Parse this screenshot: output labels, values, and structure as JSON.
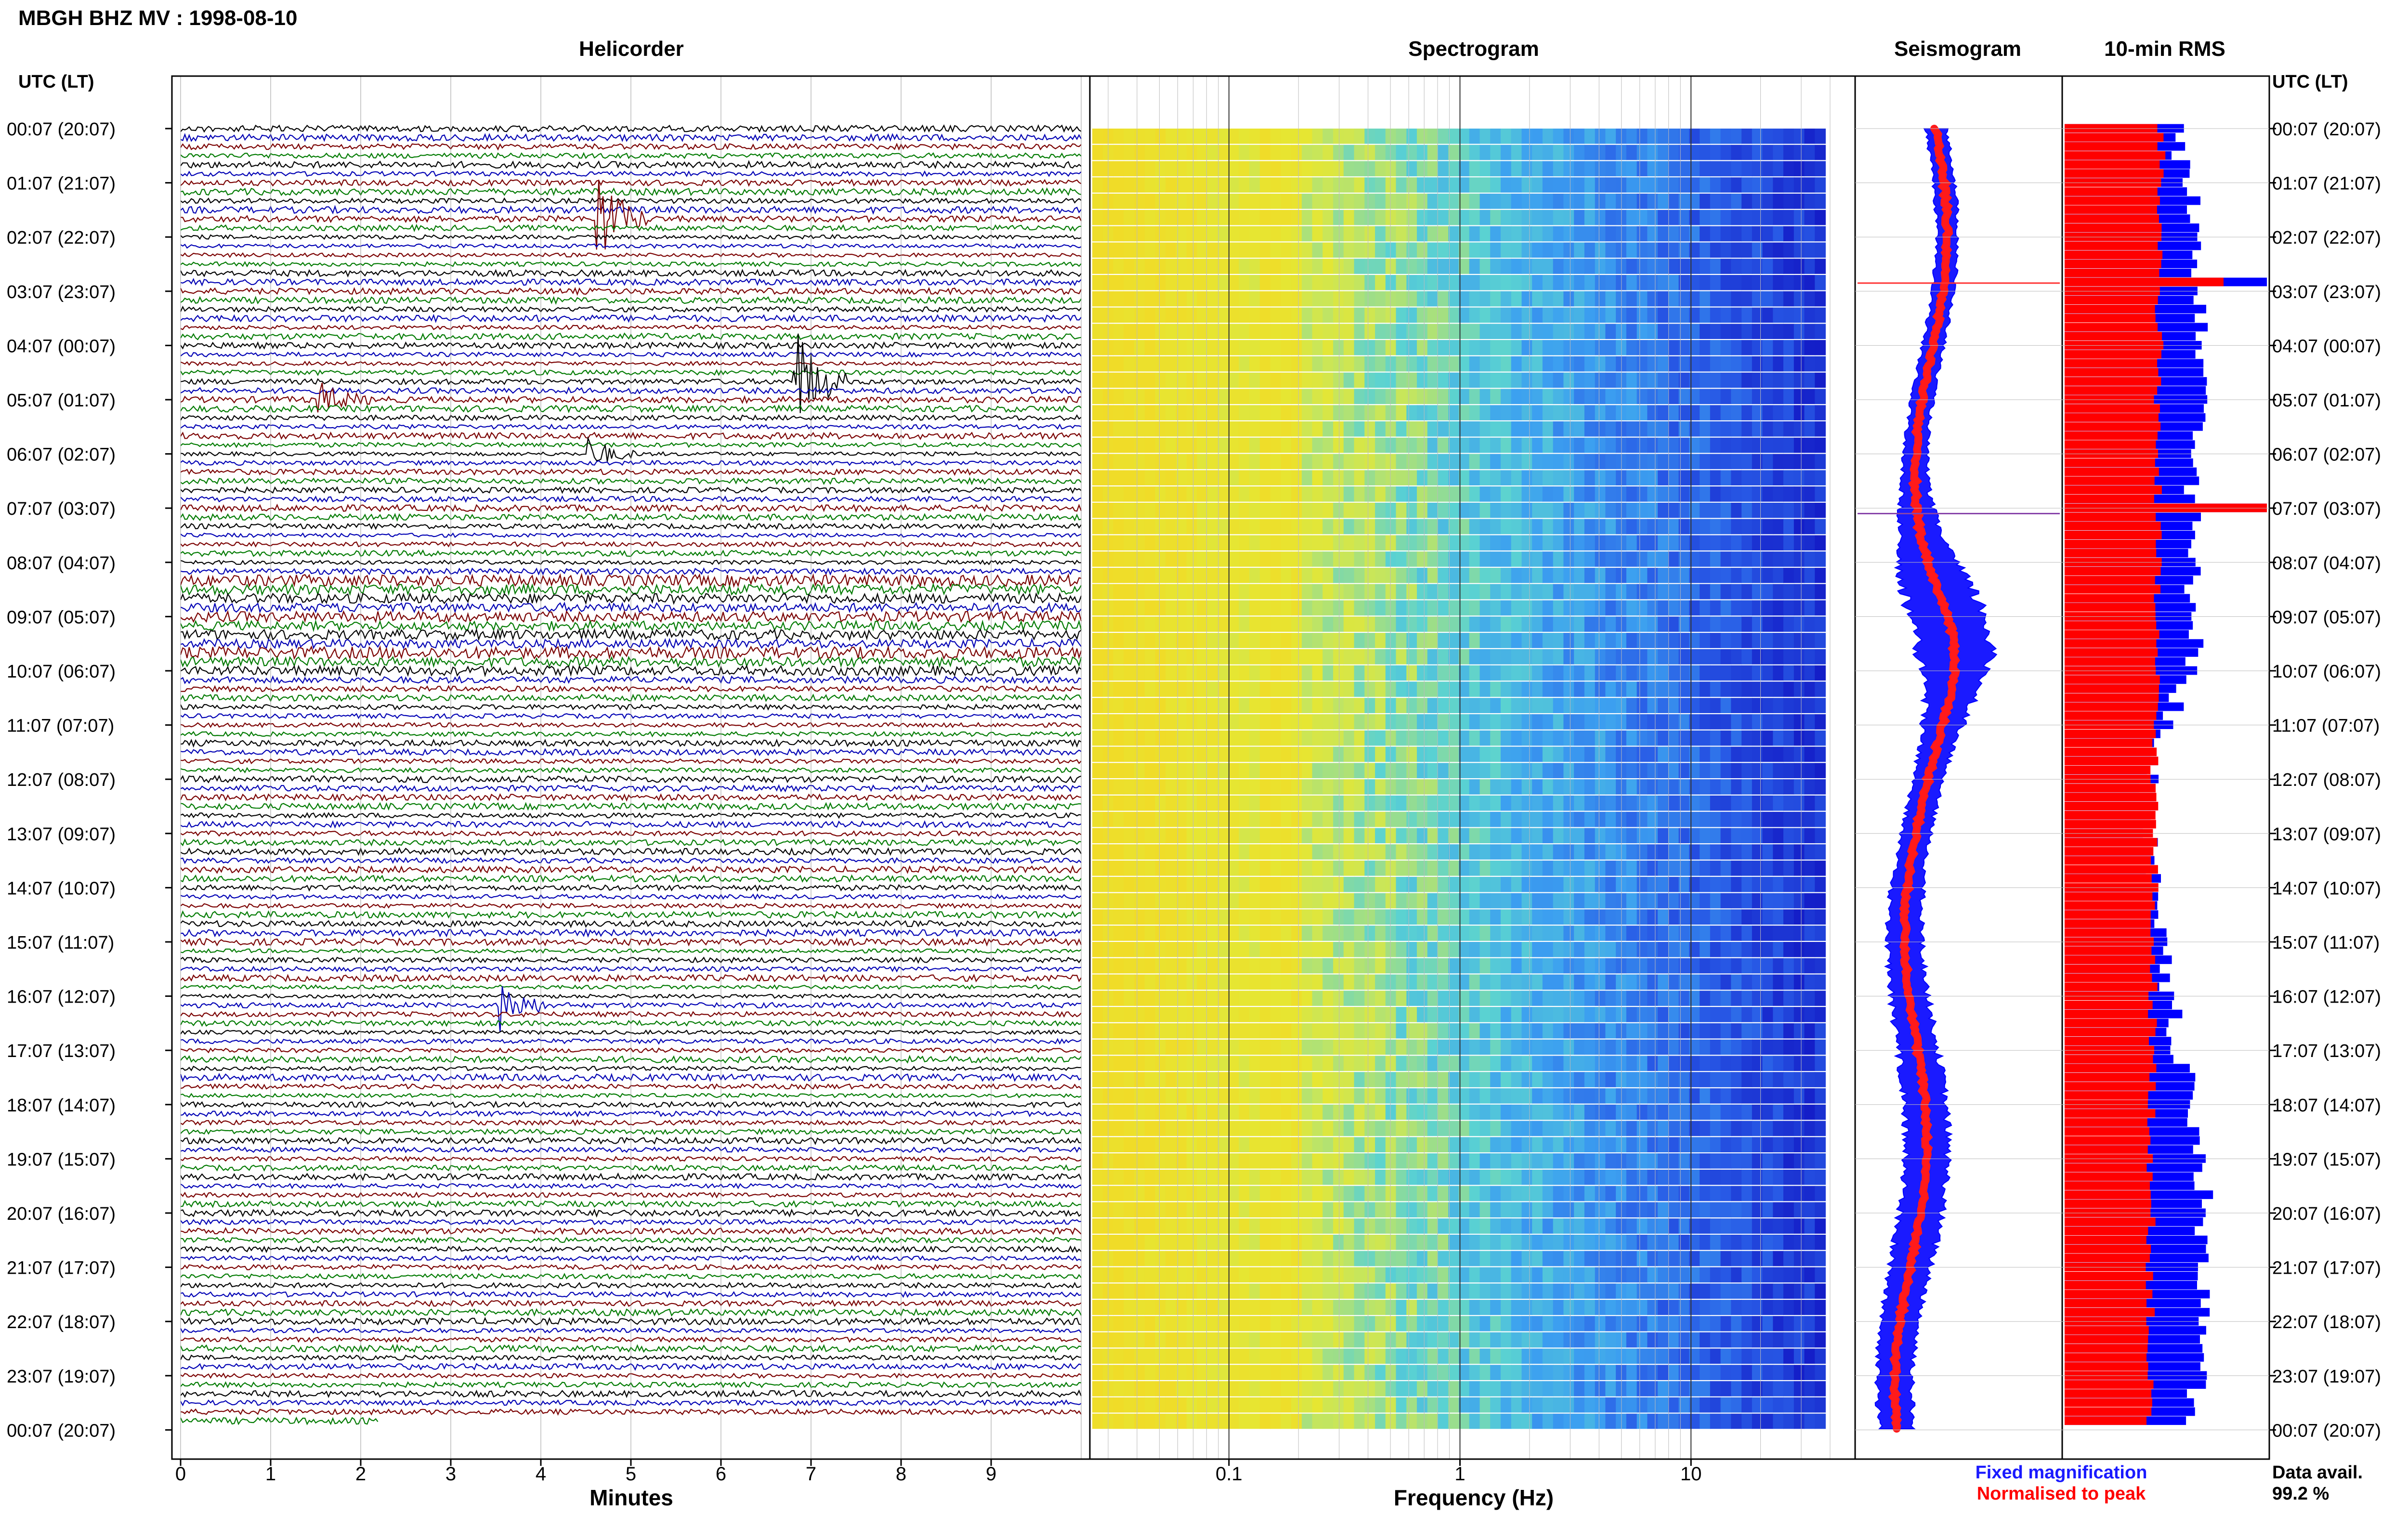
{
  "header": {
    "title": "MBGH BHZ MV : 1998-08-10"
  },
  "panels": {
    "helicorder_title": "Helicorder",
    "spectrogram_title": "Spectrogram",
    "seismogram_title": "Seismogram",
    "rms_title": "10-min RMS"
  },
  "axes": {
    "left_time_label": "UTC (LT)",
    "right_time_label": "UTC (LT)",
    "minutes_label": "Minutes",
    "frequency_label": "Frequency (Hz)"
  },
  "legend": {
    "fixed": "Fixed magnification",
    "normalised": "Normalised to peak",
    "fixed_color": "#0000ff",
    "normalised_color": "#ff0000"
  },
  "availability": {
    "label": "Data avail.",
    "value": "99.2 %"
  },
  "chart_data": [
    {
      "type": "line",
      "panel": "Helicorder",
      "xlabel": "Minutes",
      "ylabel": "UTC (LT)",
      "x_ticks": [
        "0",
        "1",
        "2",
        "3",
        "4",
        "5",
        "6",
        "7",
        "8",
        "9"
      ],
      "xlim": [
        0,
        10
      ],
      "time_labels": [
        "00:07 (20:07)",
        "01:07 (21:07)",
        "02:07 (22:07)",
        "03:07 (23:07)",
        "04:07 (00:07)",
        "05:07 (01:07)",
        "06:07 (02:07)",
        "07:07 (03:07)",
        "08:07 (04:07)",
        "09:07 (05:07)",
        "10:07 (06:07)",
        "11:07 (07:07)",
        "12:07 (08:07)",
        "13:07 (09:07)",
        "14:07 (10:07)",
        "15:07 (11:07)",
        "16:07 (12:07)",
        "17:07 (13:07)",
        "18:07 (14:07)",
        "19:07 (15:07)",
        "20:07 (16:07)",
        "21:07 (17:07)",
        "22:07 (18:07)",
        "23:07 (19:07)",
        "00:07 (20:07)"
      ],
      "trace_colors": [
        "#000000",
        "#0000b4",
        "#7a0000",
        "#007a00"
      ],
      "events": [
        {
          "row": 10,
          "minute": 4.6,
          "color": "#006600",
          "amplitude": 3.0
        },
        {
          "row": 28,
          "minute": 6.8,
          "color": "#0000a0",
          "amplitude": 4.0
        },
        {
          "row": 36,
          "minute": 4.5,
          "color": "#000000",
          "amplitude": 1.5
        },
        {
          "row": 97,
          "minute": 3.5,
          "color": "#0000a0",
          "amplitude": 2.0
        },
        {
          "row": 30,
          "minute": 1.5,
          "color": "#000000",
          "amplitude": 1.0
        }
      ]
    },
    {
      "type": "heatmap",
      "panel": "Spectrogram",
      "xlabel": "Frequency (Hz)",
      "scale": "log",
      "x_ticks": [
        "0.1",
        "1",
        "10"
      ],
      "xlim": [
        0.025,
        40
      ]
    },
    {
      "type": "line",
      "panel": "Seismogram",
      "series": [
        {
          "name": "Fixed magnification",
          "color": "#0000ff"
        },
        {
          "name": "Normalised to peak",
          "color": "#ff0000"
        }
      ]
    },
    {
      "type": "bar",
      "panel": "10-min RMS",
      "series": [
        {
          "name": "Fixed magnification",
          "color": "#0000ff"
        },
        {
          "name": "Normalised to peak",
          "color": "#ff0000"
        }
      ],
      "peaks": [
        {
          "time": "03:07",
          "value": 1.0
        },
        {
          "time": "07:07",
          "value": 1.0
        }
      ]
    }
  ]
}
